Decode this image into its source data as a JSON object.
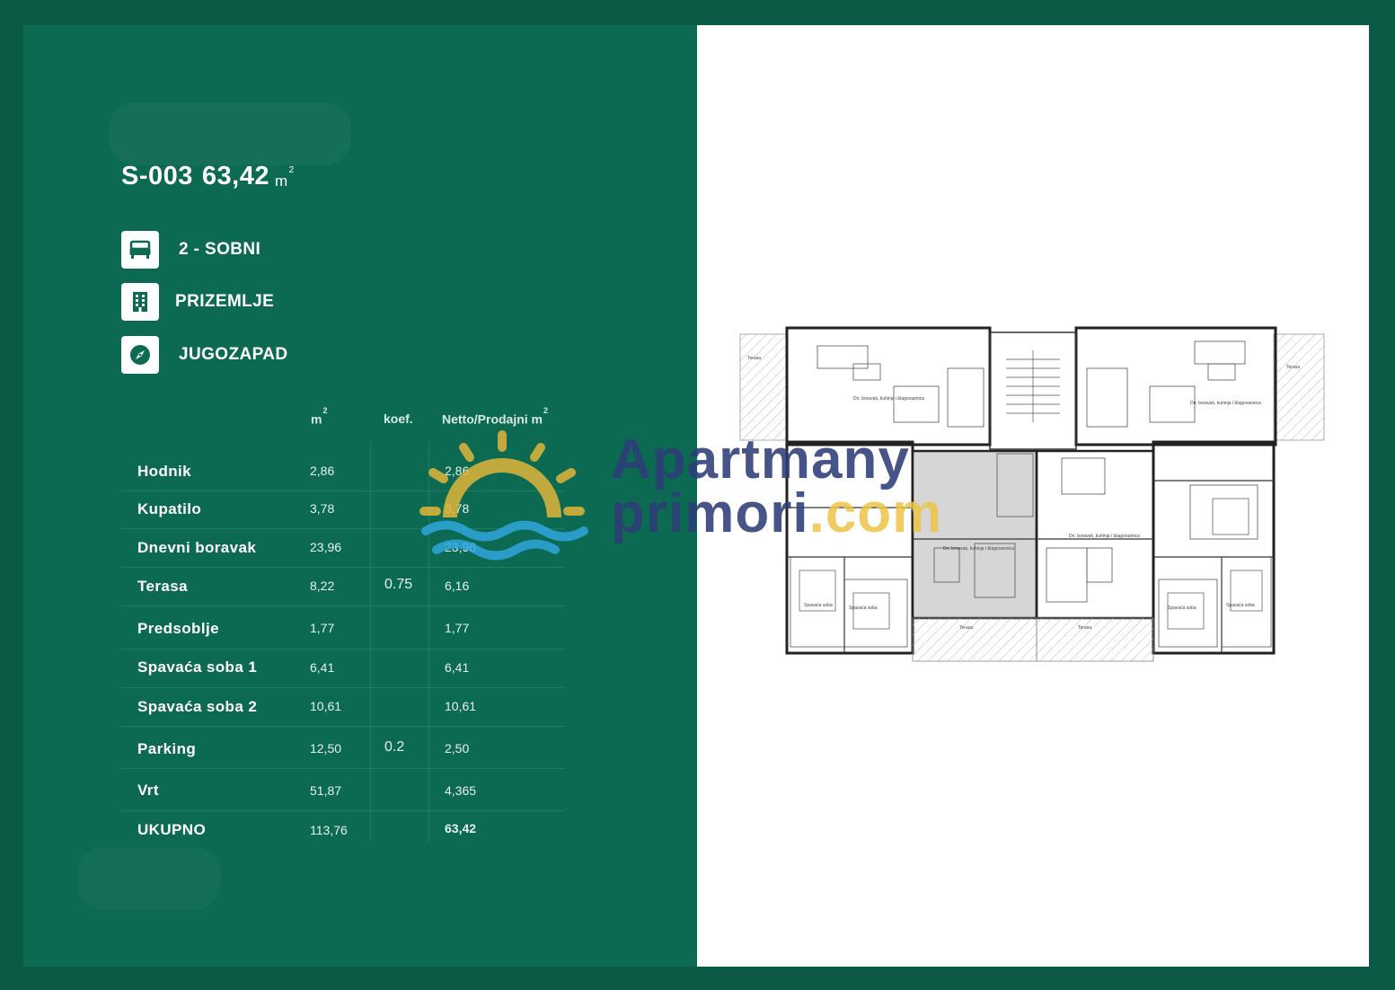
{
  "header": {
    "unit_id": "S-003",
    "area": "63,42",
    "area_unit": "m",
    "area_unit_power": "2"
  },
  "features": [
    {
      "icon": "bed-icon",
      "label": "2 - SOBNI"
    },
    {
      "icon": "building-icon",
      "label": "PRIZEMLJE"
    },
    {
      "icon": "compass-icon",
      "label": "JUGOZAPAD"
    }
  ],
  "table": {
    "headers": {
      "m2": "m",
      "m2_power": "2",
      "koef": "koef.",
      "netto": "Netto/Prodajni m",
      "netto_power": "2"
    },
    "rows": [
      {
        "name": "Hodnik",
        "m2": "2,86",
        "koef": "",
        "netto": "2,86"
      },
      {
        "name": "Kupatilo",
        "m2": "3,78",
        "koef": "",
        "netto": "3,78"
      },
      {
        "name": "Dnevni boravak",
        "m2": "23,96",
        "koef": "",
        "netto": "23,96"
      },
      {
        "name": "Terasa",
        "m2": "8,22",
        "koef": "0.75",
        "netto": "6,16"
      },
      {
        "name": "Predsoblje",
        "m2": "1,77",
        "koef": "",
        "netto": "1,77"
      },
      {
        "name": "Spavaća soba 1",
        "m2": "6,41",
        "koef": "",
        "netto": "6,41"
      },
      {
        "name": "Spavaća soba 2",
        "m2": "10,61",
        "koef": "",
        "netto": "10,61"
      },
      {
        "name": "Parking",
        "m2": "12,50",
        "koef": "0.2",
        "netto": "2,50"
      },
      {
        "name": "Vrt",
        "m2": "51,87",
        "koef": "",
        "netto": "4,365"
      },
      {
        "name": "UKUPNO",
        "m2": "113,76",
        "koef": "",
        "netto": "63,42"
      }
    ]
  },
  "watermark": {
    "line1": "Apartmany",
    "line2": "primori",
    "line2_suffix": ".com"
  },
  "colors": {
    "background": "#0a5a45",
    "panel": "#0d6a52",
    "sun": "#e0b43a",
    "waves": "#2fa6dd",
    "watermark_text": "#2d3c78"
  }
}
